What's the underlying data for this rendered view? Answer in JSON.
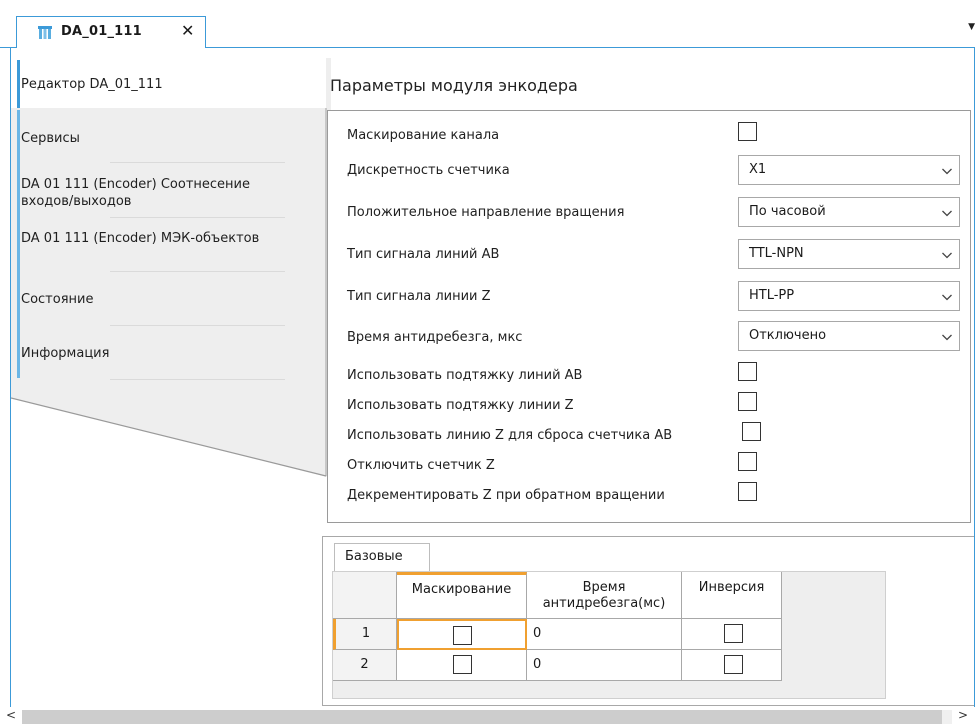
{
  "tab": {
    "title": "DA_01_111",
    "close_glyph": "✕"
  },
  "sidebar": {
    "items": [
      {
        "label": "Редактор DA_01_111"
      },
      {
        "label": "Сервисы"
      },
      {
        "label": "DA 01 111 (Encoder) Соотнесение входов/выходов"
      },
      {
        "label": "DA 01 111 (Encoder) МЭК-объектов"
      },
      {
        "label": "Состояние"
      },
      {
        "label": "Информация"
      }
    ]
  },
  "params": {
    "title": "Параметры модуля энкодера",
    "channel_mask_label": "Маскирование канала",
    "counter_resolution_label": "Дискретность счетчика",
    "counter_resolution_value": "X1",
    "positive_direction_label": "Положительное направление вращения",
    "positive_direction_value": "По часовой",
    "ab_signal_label": "Тип сигнала линий AB",
    "ab_signal_value": "TTL-NPN",
    "z_signal_label": "Тип сигнала линии Z",
    "z_signal_value": "HTL-PP",
    "debounce_label": "Время антидребезга, мкс",
    "debounce_value": "Отключено",
    "ab_pullup_label": "Использовать подтяжку линий AB",
    "z_pullup_label": "Использовать подтяжку линии Z",
    "z_reset_label": "Использовать линию Z для сброса счетчика AB",
    "disable_z_label": "Отключить счетчик Z",
    "decrement_z_label": "Декрементировать Z при обратном вращении"
  },
  "lower": {
    "subtab_label": "Базовые",
    "headers": {
      "mask": "Маскирование",
      "debounce": "Время антидребезга(мс)",
      "inversion": "Инверсия"
    },
    "rows": [
      {
        "num": "1",
        "debounce": "0"
      },
      {
        "num": "2",
        "debounce": "0"
      }
    ]
  },
  "scroll": {
    "left_glyph": "<",
    "right_glyph": ">"
  },
  "colors": {
    "accent": "#3c9ad8",
    "sidebar_bg": "#eeeeee",
    "selected_cell": "#f0a030"
  }
}
